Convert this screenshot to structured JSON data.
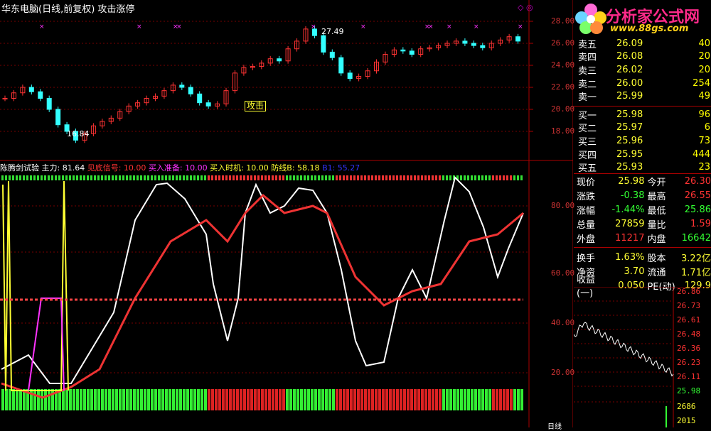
{
  "title": {
    "name": "华东电脑(日线,前复权)",
    "signal": "攻击涨停"
  },
  "price_axis": [
    "28.00",
    "26.00",
    "24.00",
    "22.00",
    "20.00",
    "18.00"
  ],
  "price_marks": {
    "high": "27.49",
    "low": "16.84",
    "signal": "攻击"
  },
  "indicator": {
    "name": "陈腾剑试验",
    "main": "主力: 81.64",
    "bottom": "见底信号: 10.00",
    "buy_prep": "买入准备: 10.00",
    "buy_time": "买入时机: 10.00",
    "defense": "防线B: 58.18",
    "b1": "B1: 55.27"
  },
  "indicator_axis": [
    "80.00",
    "60.00",
    "40.00",
    "20.00"
  ],
  "logo": {
    "text": "分析家公式网",
    "url": "www.88gs.com"
  },
  "orderbook": [
    {
      "label": "卖五",
      "price": "26.09",
      "vol": "40"
    },
    {
      "label": "卖四",
      "price": "26.08",
      "vol": "20"
    },
    {
      "label": "卖三",
      "price": "26.02",
      "vol": "20"
    },
    {
      "label": "卖二",
      "price": "26.00",
      "vol": "254"
    },
    {
      "label": "卖一",
      "price": "25.99",
      "vol": "49"
    },
    {
      "label": "买一",
      "price": "25.98",
      "vol": "96"
    },
    {
      "label": "买二",
      "price": "25.97",
      "vol": "6"
    },
    {
      "label": "买三",
      "price": "25.96",
      "vol": "73"
    },
    {
      "label": "买四",
      "price": "25.95",
      "vol": "444"
    },
    {
      "label": "买五",
      "price": "25.93",
      "vol": "23"
    }
  ],
  "stats": [
    {
      "l1": "现价",
      "v1": "25.98",
      "c1": "#ff3",
      "l2": "今开",
      "v2": "26.30",
      "c2": "#f33"
    },
    {
      "l1": "涨跌",
      "v1": "-0.38",
      "c1": "#3f3",
      "l2": "最高",
      "v2": "26.55",
      "c2": "#f33"
    },
    {
      "l1": "涨幅",
      "v1": "-1.44%",
      "c1": "#3f3",
      "l2": "最低",
      "v2": "25.86",
      "c2": "#3f3"
    },
    {
      "l1": "总量",
      "v1": "27859",
      "c1": "#ff3",
      "l2": "量比",
      "v2": "1.59",
      "c2": "#f33"
    },
    {
      "l1": "外盘",
      "v1": "11217",
      "c1": "#f33",
      "l2": "内盘",
      "v2": "16642",
      "c2": "#3f3"
    }
  ],
  "stats2": [
    {
      "l1": "换手",
      "v1": "1.63%",
      "c1": "#ff3",
      "l2": "股本",
      "v2": "3.22亿",
      "c2": "#ff3"
    },
    {
      "l1": "净资",
      "v1": "3.70",
      "c1": "#ff3",
      "l2": "流通",
      "v2": "1.71亿",
      "c2": "#ff3"
    },
    {
      "l1": "收益(一)",
      "v1": "0.050",
      "c1": "#ff3",
      "l2": "PE(动)",
      "v2": "129.9",
      "c2": "#ff3"
    }
  ],
  "mini_axis": [
    "26.86",
    "26.73",
    "26.61",
    "26.48",
    "26.36",
    "26.23",
    "26.11",
    "25.98",
    "2686",
    "2015"
  ],
  "footer": {
    "period": "日线"
  },
  "colors": {
    "up": "#ff3333",
    "down": "#33ffff",
    "grid": "#aa0000",
    "green": "#33ff33",
    "magenta": "#ff33ff",
    "yellow": "#ffff33"
  }
}
